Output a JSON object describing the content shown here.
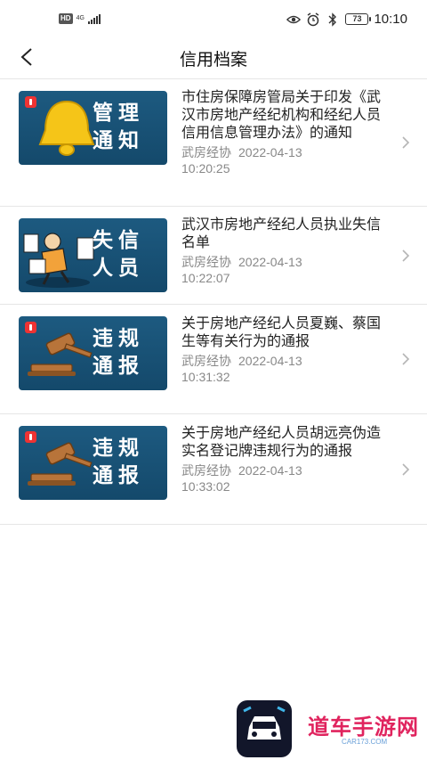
{
  "status_bar": {
    "hd": "HD",
    "network": "4G",
    "battery": "73",
    "time": "10:10"
  },
  "header": {
    "title": "信用档案"
  },
  "items": [
    {
      "thumb_label": "管理通知",
      "title": "市住房保障房管局关于印发《武汉市房地产经纪机构和经纪人员信用信息管理办法》的通知",
      "source": "武房经协",
      "date": "2022-04-13",
      "time": "10:20:25"
    },
    {
      "thumb_label": "失信人员",
      "title": "武汉市房地产经纪人员执业失信名单",
      "source": "武房经协",
      "date": "2022-04-13",
      "time": "10:22:07"
    },
    {
      "thumb_label": "违规通报",
      "title": "关于房地产经纪人员夏巍、蔡国生等有关行为的通报",
      "source": "武房经协",
      "date": "2022-04-13",
      "time": "10:31:32"
    },
    {
      "thumb_label": "违规通报",
      "title": "关于房地产经纪人员胡远亮伪造实名登记牌违规行为的通报",
      "source": "武房经协",
      "date": "2022-04-13",
      "time": "10:33:02"
    }
  ],
  "watermark": {
    "brand": "道车手游网",
    "url": "CAR173.COM"
  },
  "colors": {
    "thumb_bg": "#1d5a80",
    "meta_text": "#888888",
    "divider": "#e6e6e6"
  }
}
